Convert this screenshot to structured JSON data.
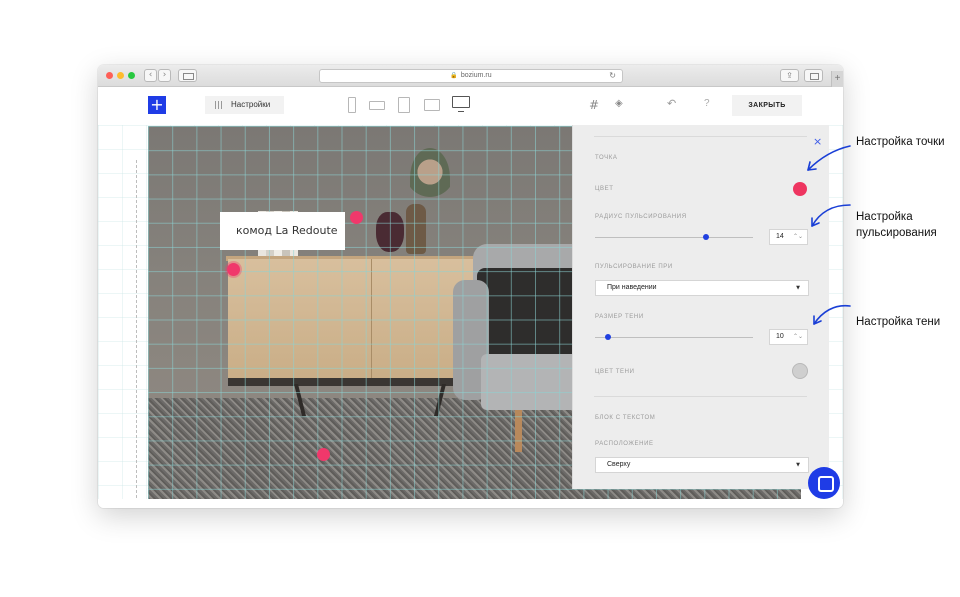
{
  "browser": {
    "url": "bozium.ru",
    "back": "‹",
    "forward": "›",
    "reload": "↻",
    "share": "⇪",
    "new_tab": "+"
  },
  "toolbar": {
    "add_label": "+",
    "settings_label": "Настройки",
    "close_label": "ЗАКРЫТЬ",
    "grid_icon": "#",
    "layers_icon": "◈",
    "undo_icon": "↶",
    "help_icon": "?"
  },
  "canvas": {
    "tooltip_text": "комод La Redoute"
  },
  "panel": {
    "close": "×",
    "point_label": "ТОЧКА",
    "color_label": "ЦВЕТ",
    "color_value": "#ee3560",
    "radius_label": "РАДИУС ПУЛЬСИРОВАНИЯ",
    "radius_value": "14",
    "radius_fraction": 0.7,
    "pulse_on_label": "ПУЛЬСИРОВАНИЕ ПРИ",
    "pulse_on_value": "При наведении",
    "shadow_size_label": "РАЗМЕР ТЕНИ",
    "shadow_size_value": "10",
    "shadow_size_fraction": 0.08,
    "shadow_color_label": "ЦВЕТ ТЕНИ",
    "shadow_color_value": "#cfcfcf",
    "text_block_label": "БЛОК С ТЕКСТОМ",
    "position_label": "РАСПОЛОЖЕНИЕ",
    "position_value": "Сверху",
    "spin_glyph": "⌃⌄",
    "caret_glyph": "▼"
  },
  "annotations": {
    "point": "Настройка точки",
    "pulse": "Настройка пульсирования",
    "shadow": "Настройка тени"
  },
  "colors": {
    "accent": "#1f3ce6",
    "hotspot": "#f0386b"
  }
}
